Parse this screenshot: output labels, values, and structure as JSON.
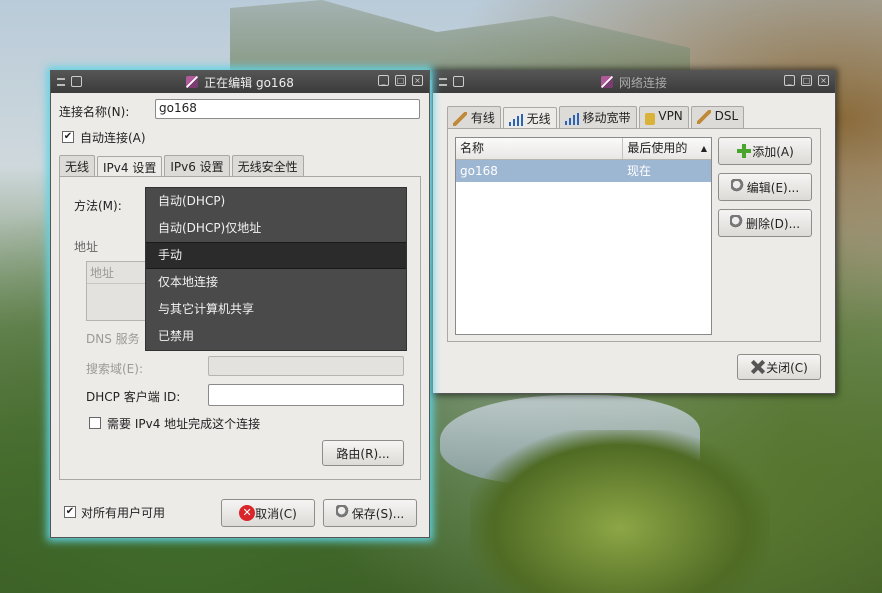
{
  "edit_window": {
    "title": "正在编辑 go168",
    "connection_name_label": "连接名称(N):",
    "connection_name_value": "go168",
    "auto_connect_label": "自动连接(A)",
    "auto_connect_checked": true,
    "tabs": [
      "无线",
      "IPv4 设置",
      "IPv6 设置",
      "无线安全性"
    ],
    "active_tab": "IPv4 设置",
    "method_label": "方法(M):",
    "address_section_label": "地址",
    "address_column_label": "地址",
    "dns_label": "DNS 服务",
    "search_domains_label": "搜索域(E):",
    "dhcp_client_id_label": "DHCP 客户端 ID:",
    "require_ipv4_label": "需要 IPv4 地址完成这个连接",
    "require_ipv4_checked": false,
    "routes_button": "路由(R)...",
    "all_users_label": "对所有用户可用",
    "all_users_checked": true,
    "cancel_button": "取消(C)",
    "save_button": "保存(S)..."
  },
  "method_dropdown": {
    "options": [
      "自动(DHCP)",
      "自动(DHCP)仅地址",
      "手动",
      "仅本地连接",
      "与其它计算机共享",
      "已禁用"
    ],
    "selected": "手动"
  },
  "network_window": {
    "title": "网络连接",
    "tabs": [
      "有线",
      "无线",
      "移动宽带",
      "VPN",
      "DSL"
    ],
    "active_tab": "无线",
    "columns": [
      "名称",
      "最后使用的"
    ],
    "sort_indicator": "▲",
    "rows": [
      {
        "name": "go168",
        "last_used": "现在"
      }
    ],
    "add_button": "添加(A)",
    "edit_button": "编辑(E)...",
    "delete_button": "删除(D)...",
    "close_button": "关闭(C)"
  },
  "colors": {
    "focus_glow": "#5fd3e3",
    "selection_row": "#9db6d2",
    "dropdown_bg": "#4a4a4a"
  }
}
